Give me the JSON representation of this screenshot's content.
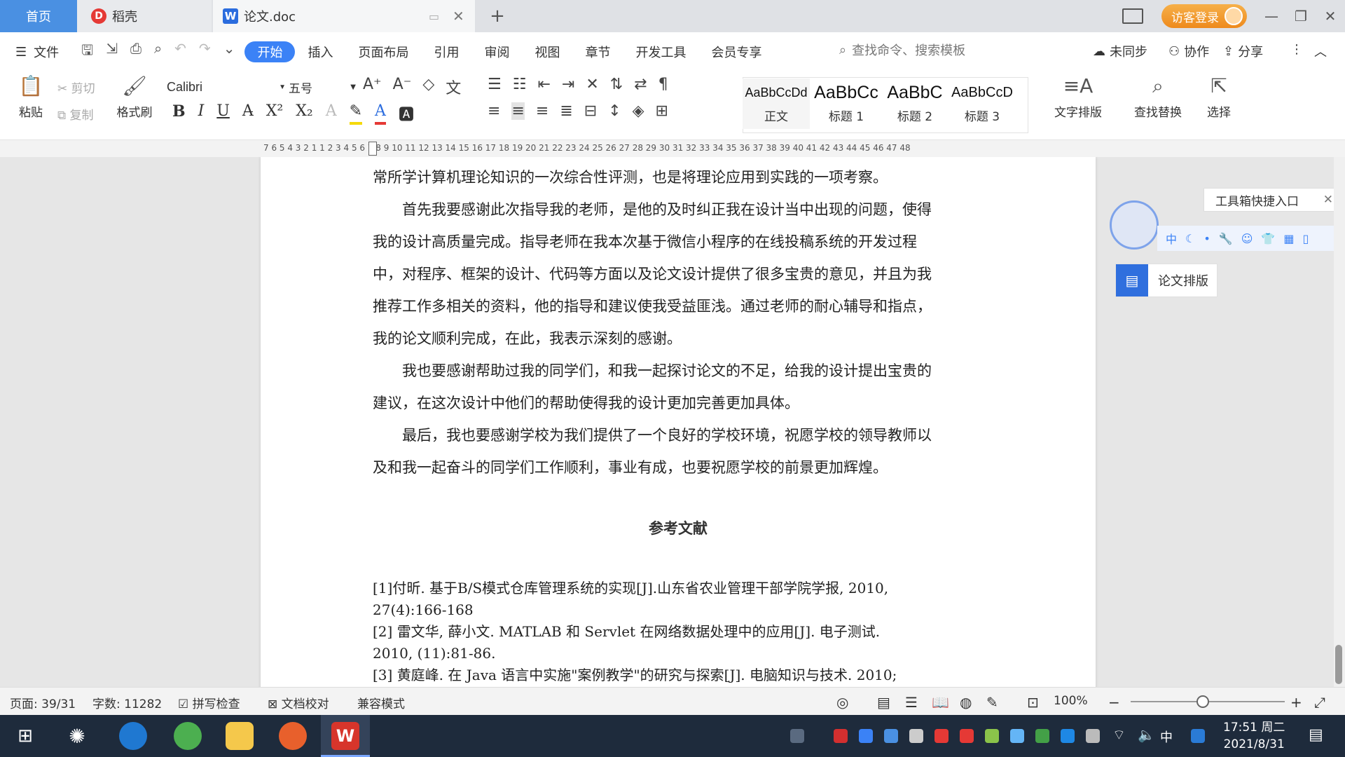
{
  "titlebar": {
    "tab_home": "首页",
    "tab_daoke": "稻壳",
    "tab_doc": "论文.doc",
    "login_label": "访客登录"
  },
  "menu": {
    "file": "文件",
    "items": [
      "开始",
      "插入",
      "页面布局",
      "引用",
      "审阅",
      "视图",
      "章节",
      "开发工具",
      "会员专享"
    ],
    "search_placeholder": "查找命令、搜索模板",
    "unsynced": "未同步",
    "collaborate": "协作",
    "share": "分享"
  },
  "ribbon": {
    "paste": "粘贴",
    "cut": "剪切",
    "copy": "复制",
    "format_painter": "格式刷",
    "font_name": "Calibri",
    "font_size": "五号",
    "styles": [
      {
        "sample": "AaBbCcDd",
        "name": "正文"
      },
      {
        "sample": "AaBbCc",
        "name": "标题 1"
      },
      {
        "sample": "AaBbC",
        "name": "标题 2"
      },
      {
        "sample": "AaBbCcD",
        "name": "标题 3"
      }
    ],
    "text_layout": "文字排版",
    "find_replace": "查找替换",
    "select": "选择"
  },
  "ruler": {
    "numbers": "7  6  5  4  3  2  1     1  2  3  4  5  6  7  8  9 10 11 12 13 14 15 16 17 18 19 20 21 22 23 24 25 26 27 28 29 30 31 32 33 34 35 36 37 38 39 40 41 42 43 44 45 46 47 48"
  },
  "document": {
    "paragraphs": [
      "常所学计算机理论知识的一次综合性评测，也是将理论应用到实践的一项考察。",
      "首先我要感谢此次指导我的老师，是他的及时纠正我在设计当中出现的问题，使得",
      "我的设计高质量完成。指导老师在我本次基于微信小程序的在线投稿系统的开发过程",
      "中，对程序、框架的设计、代码等方面以及论文设计提供了很多宝贵的意见，并且为我",
      "推荐工作多相关的资料，他的指导和建议使我受益匪浅。通过老师的耐心辅导和指点，",
      "我的论文顺利完成，在此，我表示深刻的感谢。",
      "我也要感谢帮助过我的同学们，和我一起探讨论文的不足，给我的设计提出宝贵的",
      "建议，在这次设计中他们的帮助使得我的设计更加完善更加具体。",
      "最后，我也要感谢学校为我们提供了一个良好的学校环境，祝愿学校的领导教师以",
      "及和我一起奋斗的同学们工作顺利，事业有成，也要祝愿学校的前景更加辉煌。"
    ],
    "ref_title": "参考文献",
    "refs": [
      "[1]付昕. 基于B/S模式仓库管理系统的实现[J].山东省农业管理干部学院学报, 2010,",
      "27(4):166-168",
      "[2] 雷文华, 薛小文. MATLAB 和 Servlet 在网络数据处理中的应用[J]. 电子测试.",
      "2010, (11):81-86.",
      "[3] 黄庭峰. 在 Java 语言中实施\"案例教学\"的研究与探索[J]. 电脑知识与技术. 2010;"
    ]
  },
  "right_panel": {
    "toolbox_label": "工具箱快捷入口",
    "lunwen_label": "论文排版"
  },
  "status": {
    "page": "页面: 39/31",
    "wordcount": "字数: 11282",
    "spellcheck": "拼写检查",
    "doc_check": "文档校对",
    "compat": "兼容模式",
    "zoom": "100%"
  },
  "taskbar": {
    "time": "17:51 周二",
    "date": "2021/8/31",
    "ime": "中"
  },
  "colors": {
    "accent": "#3b82f6",
    "login": "#f0951f",
    "taskbar": "#1e2b3c"
  }
}
